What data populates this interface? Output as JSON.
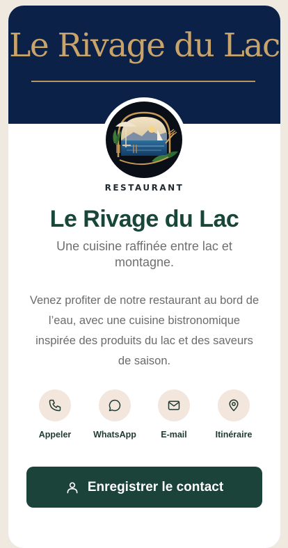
{
  "banner": {
    "title": "Le Rivage du Lac",
    "colors": {
      "background": "#0c2147",
      "gold": "#c9a46a"
    }
  },
  "logo": {
    "icon": "lake-terrace-logo"
  },
  "profile": {
    "category": "RESTAURANT",
    "name": "Le Rivage du Lac",
    "tagline": "Une cuisine raffinée entre lac et montagne.",
    "description": "Venez profiter de notre restaurant au bord de l’eau, avec une cuisine bistronomique inspirée des produits du lac et des saveurs de saison."
  },
  "actions": [
    {
      "label": "Appeler",
      "icon": "phone-icon"
    },
    {
      "label": "WhatsApp",
      "icon": "chat-bubble-icon"
    },
    {
      "label": "E-mail",
      "icon": "mail-icon"
    },
    {
      "label": "Itinéraire",
      "icon": "map-pin-icon"
    }
  ],
  "save_button": {
    "label": "Enregistrer le contact",
    "icon": "user-icon"
  },
  "colors": {
    "accent": "#1b4339",
    "heading": "#18473a",
    "icon_circle": "#f3e6dc",
    "page": "#efe9df"
  }
}
